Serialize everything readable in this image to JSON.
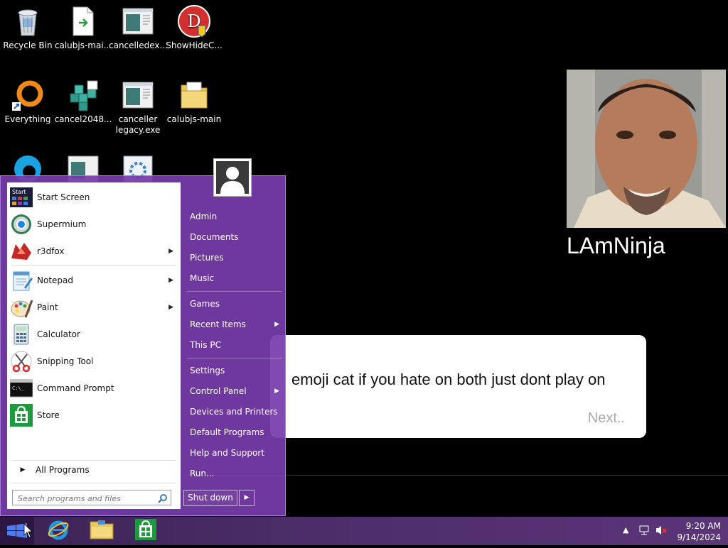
{
  "desktop": {
    "icons": [
      {
        "label": "Recycle Bin"
      },
      {
        "label": "calubjs-mai..."
      },
      {
        "label": "cancelledex..."
      },
      {
        "label": "ShowHideC..."
      },
      {
        "label": "Everything"
      },
      {
        "label": "cancel2048..."
      },
      {
        "label": "canceller legacy.exe"
      },
      {
        "label": "calubjs-main"
      }
    ]
  },
  "video": {
    "player_name": "LAmNinja",
    "dialog_text": "emoji cat if you hate on both just dont play on",
    "dialog_next": "Next.."
  },
  "start_menu": {
    "programs": [
      {
        "label": "Start Screen",
        "icon": "start-screen-icon"
      },
      {
        "label": "Supermium",
        "icon": "supermium-icon"
      },
      {
        "label": "r3dfox",
        "icon": "r3dfox-icon",
        "submenu": true
      },
      {
        "label": "Notepad",
        "icon": "notepad-icon",
        "submenu": true
      },
      {
        "label": "Paint",
        "icon": "paint-icon",
        "submenu": true
      },
      {
        "label": "Calculator",
        "icon": "calculator-icon"
      },
      {
        "label": "Snipping Tool",
        "icon": "scissors-icon"
      },
      {
        "label": "Command Prompt",
        "icon": "terminal-icon"
      },
      {
        "label": "Store",
        "icon": "store-icon"
      }
    ],
    "start_screen_badge": "Start",
    "all_programs": "All Programs",
    "search_placeholder": "Search programs and files",
    "right_items": [
      {
        "label": "Admin"
      },
      {
        "label": "Documents"
      },
      {
        "label": "Pictures"
      },
      {
        "label": "Music"
      },
      {
        "label": "Games"
      },
      {
        "label": "Recent Items",
        "submenu": true
      },
      {
        "label": "This PC"
      },
      {
        "label": "Settings"
      },
      {
        "label": "Control Panel",
        "submenu": true
      },
      {
        "label": "Devices and Printers"
      },
      {
        "label": "Default Programs"
      },
      {
        "label": "Help and Support"
      },
      {
        "label": "Run..."
      }
    ],
    "shutdown_label": "Shut down"
  },
  "taskbar": {
    "pinned": [
      "internet-explorer-icon",
      "file-explorer-icon",
      "store-icon"
    ],
    "time": "9:20 AM",
    "date": "9/14/2024"
  },
  "colors": {
    "start_menu": "#7a3fb0",
    "taskbar": "#4e2e6c"
  }
}
